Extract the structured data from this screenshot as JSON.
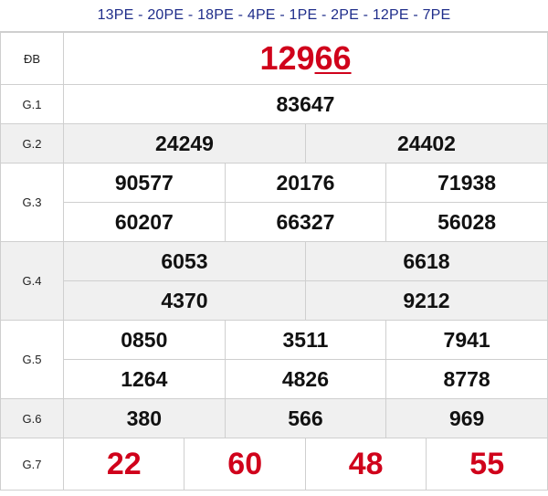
{
  "header_codes": "13PE - 20PE - 18PE - 4PE - 1PE - 2PE - 12PE - 7PE",
  "labels": {
    "db": "ĐB",
    "g1": "G.1",
    "g2": "G.2",
    "g3": "G.3",
    "g4": "G.4",
    "g5": "G.5",
    "g6": "G.6",
    "g7": "G.7"
  },
  "prizes": {
    "db_head": "129",
    "db_tail": "66",
    "g1": [
      "83647"
    ],
    "g2": [
      "24249",
      "24402"
    ],
    "g3": [
      "90577",
      "20176",
      "71938",
      "60207",
      "66327",
      "56028"
    ],
    "g4": [
      "6053",
      "6618",
      "4370",
      "9212"
    ],
    "g5": [
      "0850",
      "3511",
      "7941",
      "1264",
      "4826",
      "8778"
    ],
    "g6": [
      "380",
      "566",
      "969"
    ],
    "g7": [
      "22",
      "60",
      "48",
      "55"
    ]
  },
  "colors": {
    "header_text": "#1f2d8a",
    "special_prize": "#d0021b",
    "g7_prize": "#d0021b",
    "alt_row_bg": "#f0f0f0"
  }
}
